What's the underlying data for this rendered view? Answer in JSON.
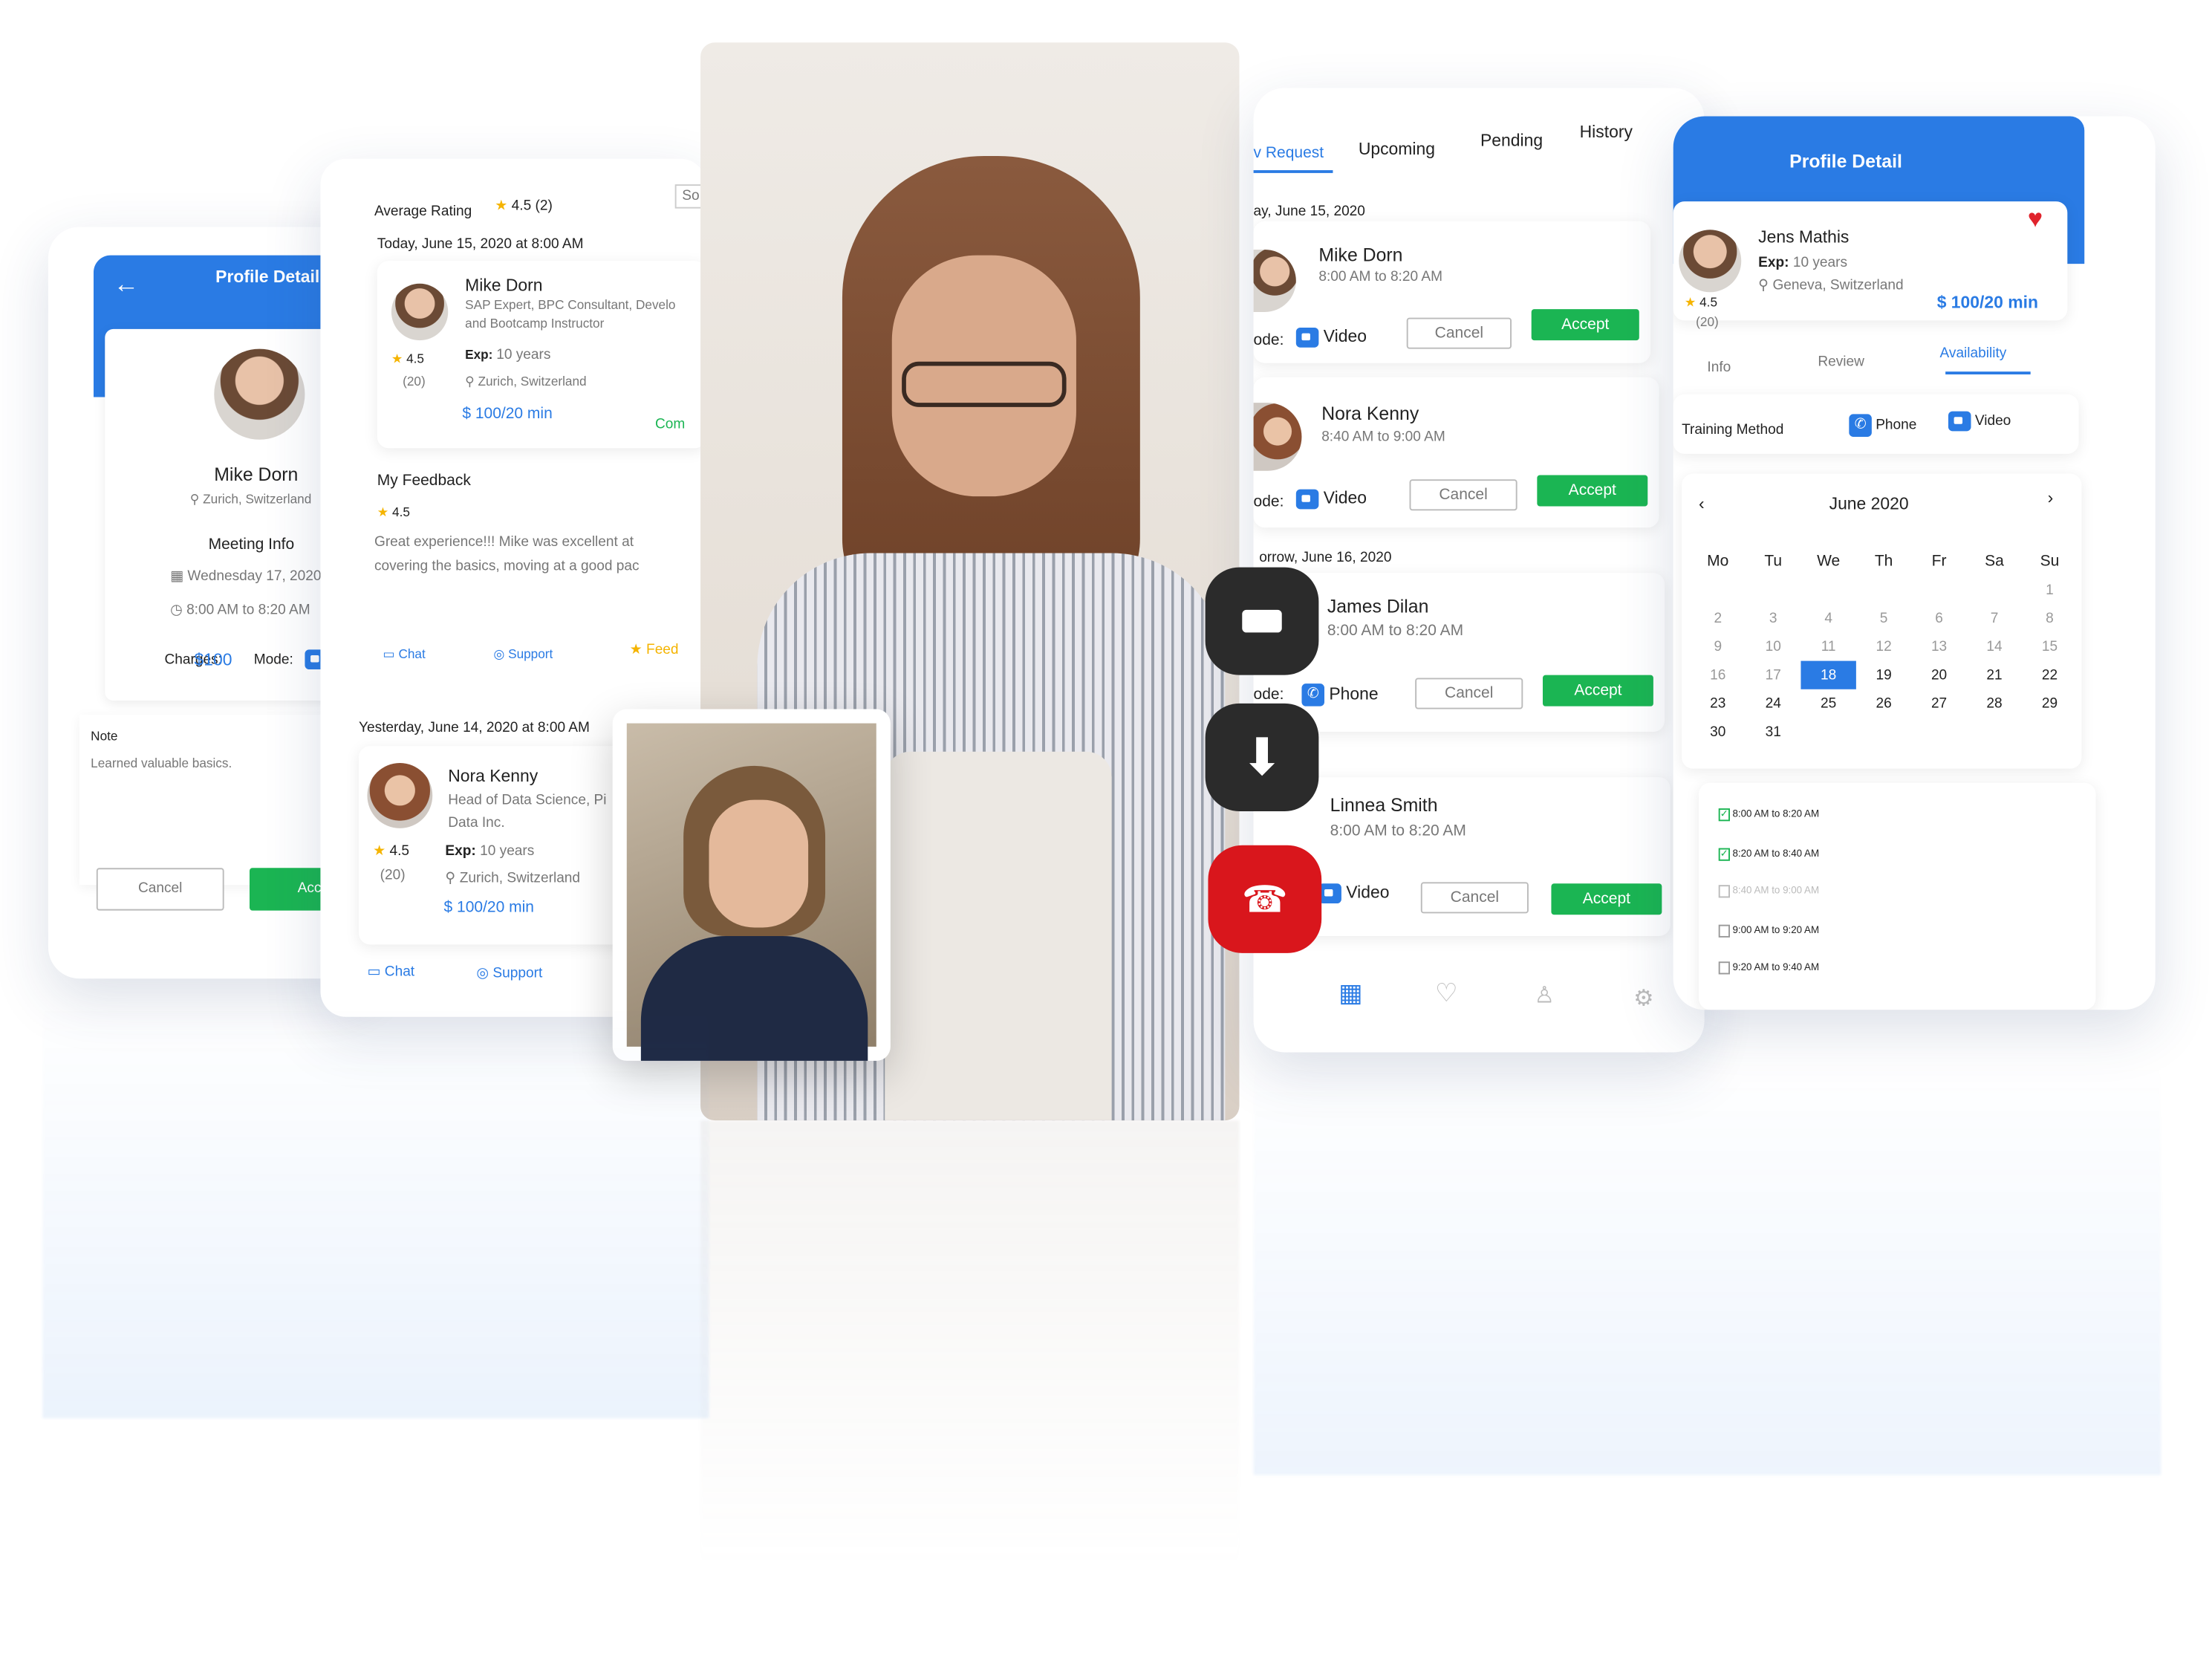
{
  "left_card": {
    "header_title": "Profile Detail",
    "name": "Mike Dorn",
    "location": "Zurich, Switzerland",
    "meeting_info_label": "Meeting Info",
    "date": "Wednesday 17, 2020",
    "time": "8:00 AM to 8:20 AM",
    "charges_label": "Charges:",
    "charges_value": "$100",
    "mode_label": "Mode:",
    "note_label": "Note",
    "note_text": "Learned valuable basics.",
    "cancel_label": "Cancel",
    "accept_label": "Acce"
  },
  "feedback_card": {
    "avg_rating_label": "Average Rating",
    "avg_rating_value": "4.5 (2)",
    "sort_label": "So",
    "today_label": "Today, June 15, 2020 at 8:00 AM",
    "entry1": {
      "name": "Mike Dorn",
      "title_line1": "SAP Expert, BPC Consultant, Develo",
      "title_line2": "and Bootcamp Instructor",
      "rating": "4.5",
      "reviews": "(20)",
      "exp_label": "Exp:",
      "exp_value": "10 years",
      "location": "Zurich, Switzerland",
      "price": "$ 100/20 min",
      "status": "Com"
    },
    "my_feedback_label": "My Feedback",
    "my_feedback_rating": "4.5",
    "feedback_line1": "Great experience!!! Mike was excellent at",
    "feedback_line2": "covering the basics, moving at a good pac",
    "chat_label": "Chat",
    "support_label": "Support",
    "feedback_btn": "Feed",
    "yesterday_label": "Yesterday, June 14, 2020 at 8:00 AM",
    "entry2": {
      "name": "Nora Kenny",
      "title_line1": "Head of Data Science, Pi",
      "title_line2": "Data Inc.",
      "rating": "4.5",
      "reviews": "(20)",
      "exp_label": "Exp:",
      "exp_value": "10 years",
      "location": "Zurich, Switzerland",
      "price": "$ 100/20 min"
    },
    "chat_label2": "Chat",
    "support_label2": "Support"
  },
  "requests_card": {
    "tabs": [
      "v Request",
      "Upcoming",
      "Pending",
      "History"
    ],
    "active_tab": 0,
    "group1": "ay, June 15, 2020",
    "group2": "orrow, June 16, 2020",
    "mode_prefix": "ode:",
    "items": [
      {
        "name": "Mike Dorn",
        "time": "8:00 AM to 8:20 AM",
        "mode": "Video",
        "cancel": "Cancel",
        "accept": "Accept"
      },
      {
        "name": "Nora Kenny",
        "time": "8:40 AM to 9:00 AM",
        "mode": "Video",
        "cancel": "Cancel",
        "accept": "Accept"
      },
      {
        "name": "James Dilan",
        "time": "8:00 AM to 8:20 AM",
        "mode": "Phone",
        "cancel": "Cancel",
        "accept": "Accept"
      },
      {
        "name": "Linnea Smith",
        "time": "8:00 AM to 8:20 AM",
        "mode": "Video",
        "cancel": "Cancel",
        "accept": "Accept"
      }
    ],
    "nav_icons": [
      "home-icon",
      "calendar-icon",
      "heart-icon",
      "user-icon",
      "gear-icon"
    ]
  },
  "profile_card": {
    "header_title": "Profile Detail",
    "name": "Jens Mathis",
    "exp_label": "Exp:",
    "exp_value": "10 years",
    "location": "Geneva, Switzerland",
    "rating": "4.5",
    "reviews": "(20)",
    "price": "$ 100/20 min",
    "tabs": [
      "Info",
      "Review",
      "Availability"
    ],
    "active_tab": 2,
    "training_label": "Training Method",
    "phone_label": "Phone",
    "video_label": "Video",
    "month_label": "June 2020",
    "weekdays": [
      "Mo",
      "Tu",
      "We",
      "Th",
      "Fr",
      "Sa",
      "Su"
    ],
    "week0": [
      "",
      "",
      "",
      "",
      "",
      "",
      "1"
    ],
    "week1": [
      "2",
      "3",
      "4",
      "5",
      "6",
      "7",
      "8"
    ],
    "week2": [
      "9",
      "10",
      "11",
      "12",
      "13",
      "14",
      "15"
    ],
    "week3": [
      "16",
      "17",
      "18",
      "19",
      "20",
      "21",
      "22"
    ],
    "week4": [
      "23",
      "24",
      "25",
      "26",
      "27",
      "28",
      "29"
    ],
    "week5": [
      "30",
      "31",
      "",
      "",
      "",
      "",
      ""
    ],
    "selected_day": "18",
    "slots": [
      "8:00 AM to 8:20 AM",
      "8:20 AM to 8:40 AM",
      "8:40 AM to 9:00 AM",
      "9:00 AM to 9:20 AM",
      "9:20 AM to 9:40 AM"
    ],
    "slots_checked": [
      true,
      true,
      false,
      false,
      false
    ]
  },
  "call_controls": [
    "video-camera-icon",
    "download-icon",
    "hang-up-icon"
  ],
  "colors": {
    "accent": "#2a7be4",
    "accept": "#1bb553",
    "hangup": "#d9161c",
    "control": "#2b2b2b"
  }
}
